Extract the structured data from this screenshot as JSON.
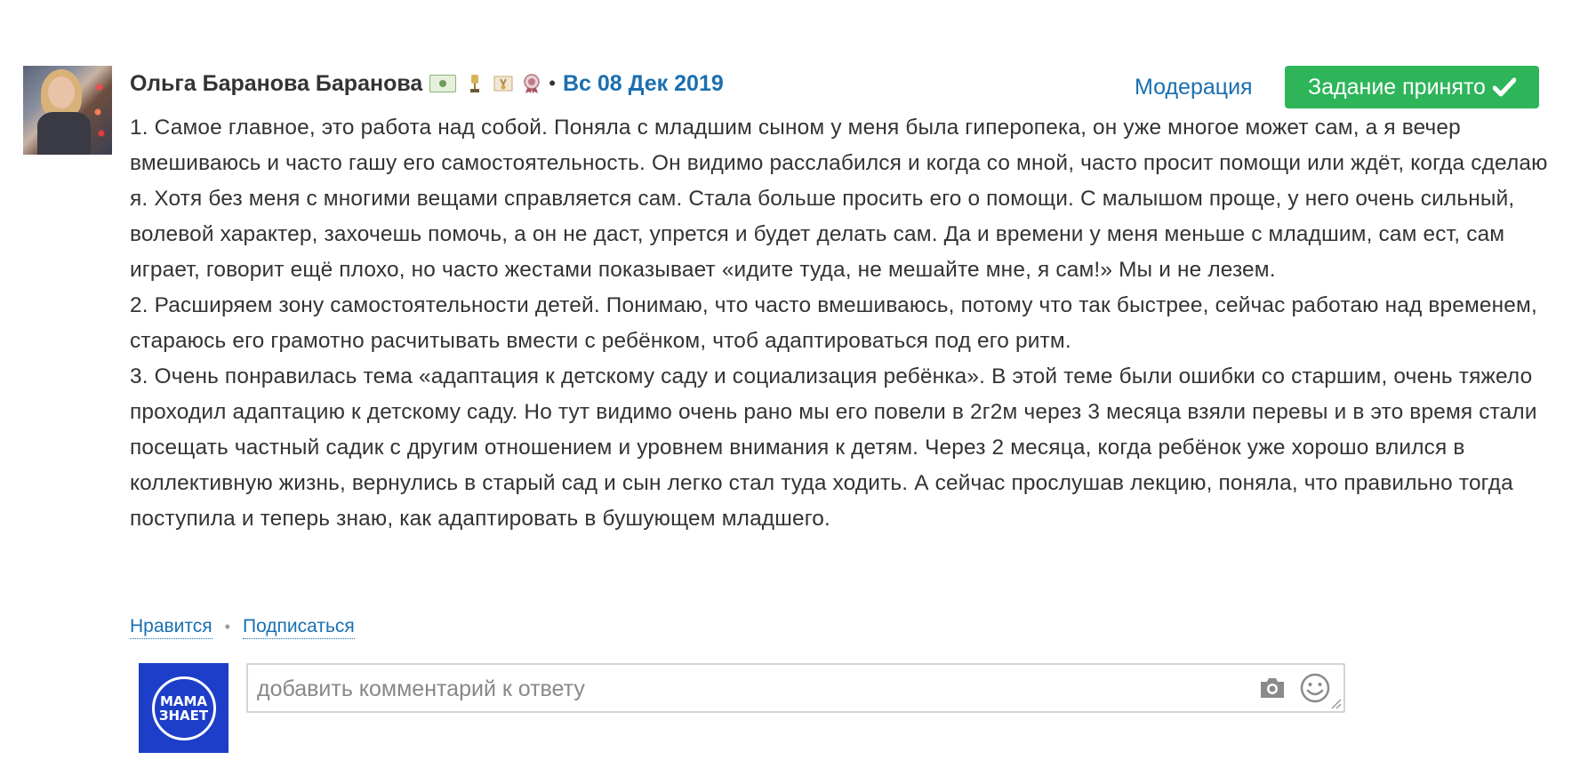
{
  "answer": {
    "author": "Ольга Баранова Баранова",
    "separator": "•",
    "date": "Вс 08 Дек 2019",
    "moderation_label": "Модерация",
    "accepted_label": "Задание принято",
    "paragraphs": [
      "1. Самое главное, это работа над собой. Поняла с младшим сыном у меня была гиперопека, он уже многое может сам, а я вечер вмешиваюсь и часто гашу его самостоятельность. Он видимо расслабился и когда со мной, часто просит помощи или ждёт, когда сделаю я. Хотя без меня с многими вещами справляется сам. Стала больше просить его о помощи. С малышом проще, у него очень сильный, волевой характер, захочешь помочь, а он не даст, упрется и будет делать сам. Да и времени у меня меньше с младшим, сам ест, сам играет, говорит ещё плохо, но часто жестами показывает «идите туда, не мешайте мне, я сам!» Мы и не лезем.",
      "2. Расширяем зону самостоятельности детей. Понимаю, что часто вмешиваюсь, потому что так быстрее, сейчас работаю над временем, стараюсь его грамотно расчитывать вмести с ребёнком, чтоб адаптироваться под его ритм.",
      "3. Очень понравилась тема «адаптация к детскому саду и социализация ребёнка». В этой теме были ошибки со старшим, очень тяжело проходил адаптацию к детскому саду. Но тут видимо очень рано мы его повели в 2г2м через 3 месяца взяли перевы и в это время стали посещать частный садик с другим отношением и уровнем внимания к детям. Через 2 месяца, когда ребёнок уже хорошо влился в коллективную жизнь, вернулись в старый сад и сын легко стал туда ходить. А сейчас прослушав лекцию, поняла, что правильно тогда поступила и теперь знаю, как адаптировать в бушующем младшего."
    ],
    "actions": {
      "like_label": "Нравится",
      "dot": "•",
      "subscribe_label": "Подписаться"
    }
  },
  "comment": {
    "placeholder": "добавить комментарий к ответу",
    "logo_line1": "МАМА",
    "logo_line2": "ЗНАЕТ"
  },
  "icons": {
    "badges": [
      "money-badge-icon",
      "trophy-badge-icon",
      "certificate-badge-icon",
      "medal-badge-icon"
    ],
    "check": "check-icon",
    "camera": "camera-icon",
    "smile": "smile-icon"
  },
  "colors": {
    "link": "#1a6fb0",
    "accept_button": "#2eb55a",
    "logo_bg": "#1d3ec9",
    "text": "#333333"
  }
}
